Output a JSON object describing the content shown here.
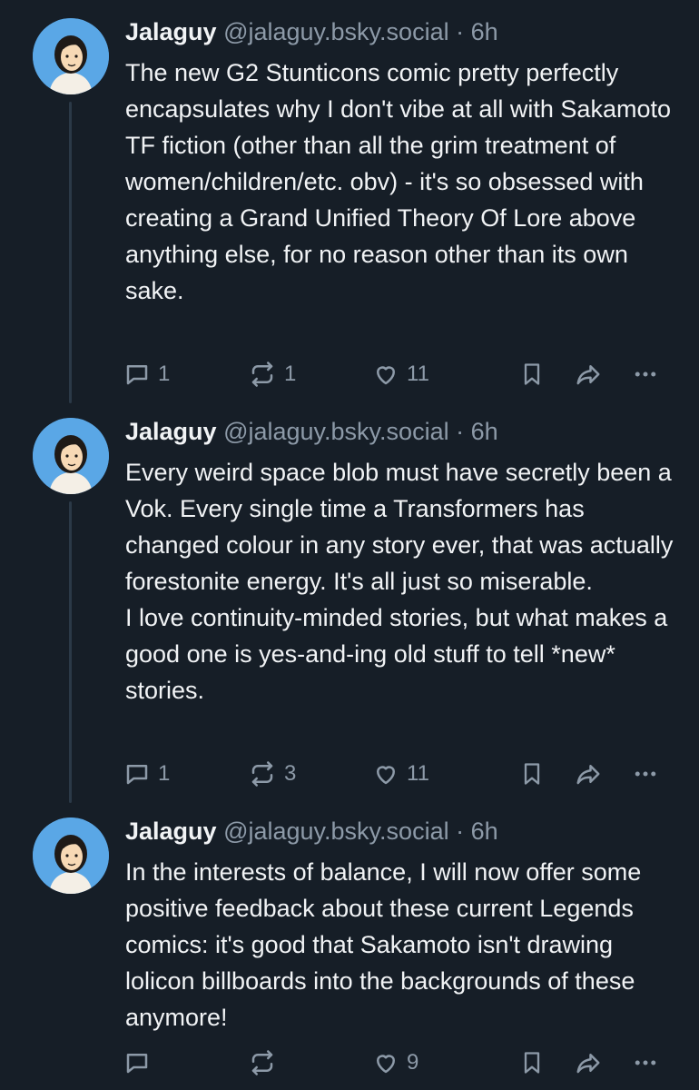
{
  "posts": [
    {
      "author": {
        "display_name": "Jalaguy",
        "handle": "@jalaguy.bsky.social",
        "time": "6h"
      },
      "separator": "·",
      "text_lines": [
        "The new G2 Stunticons comic pretty perfectly encapsulates why I don't vibe at all with Sakamoto TF fiction (other than all the grim treatment of women/children/etc. obv) - it's so obsessed with creating a Grand Unified Theory Of Lore above anything else, for no reason other than its own sake."
      ],
      "stats": {
        "replies": "1",
        "reposts": "1",
        "likes": "11"
      }
    },
    {
      "author": {
        "display_name": "Jalaguy",
        "handle": "@jalaguy.bsky.social",
        "time": "6h"
      },
      "separator": "·",
      "text_lines": [
        "Every weird space blob must have secretly been a Vok. Every single time a Transformers has changed colour in any story ever, that was actually forestonite energy. It's all just so miserable.",
        "I love continuity-minded stories, but what makes a good one is yes-and-ing old stuff to tell *new* stories."
      ],
      "stats": {
        "replies": "1",
        "reposts": "3",
        "likes": "11"
      }
    },
    {
      "author": {
        "display_name": "Jalaguy",
        "handle": "@jalaguy.bsky.social",
        "time": "6h"
      },
      "separator": "·",
      "text_lines": [
        "In the interests of balance, I will now offer some positive feedback about these current Legends comics: it's good that Sakamoto isn't drawing lolicon billboards into the backgrounds of these anymore!"
      ],
      "stats": {
        "replies": "",
        "reposts": "",
        "likes": "9"
      }
    }
  ],
  "icons": {
    "reply": "speech-bubble-icon",
    "repost": "repost-arrows-icon",
    "like": "heart-icon",
    "bookmark": "bookmark-icon",
    "share": "share-arrow-icon",
    "more": "ellipsis-icon"
  },
  "colors": {
    "background": "#161e27",
    "text": "#f1f3f5",
    "muted": "#8d9aa8",
    "thread_line": "#2b3947",
    "avatar_bg": "#5aa7e6"
  }
}
